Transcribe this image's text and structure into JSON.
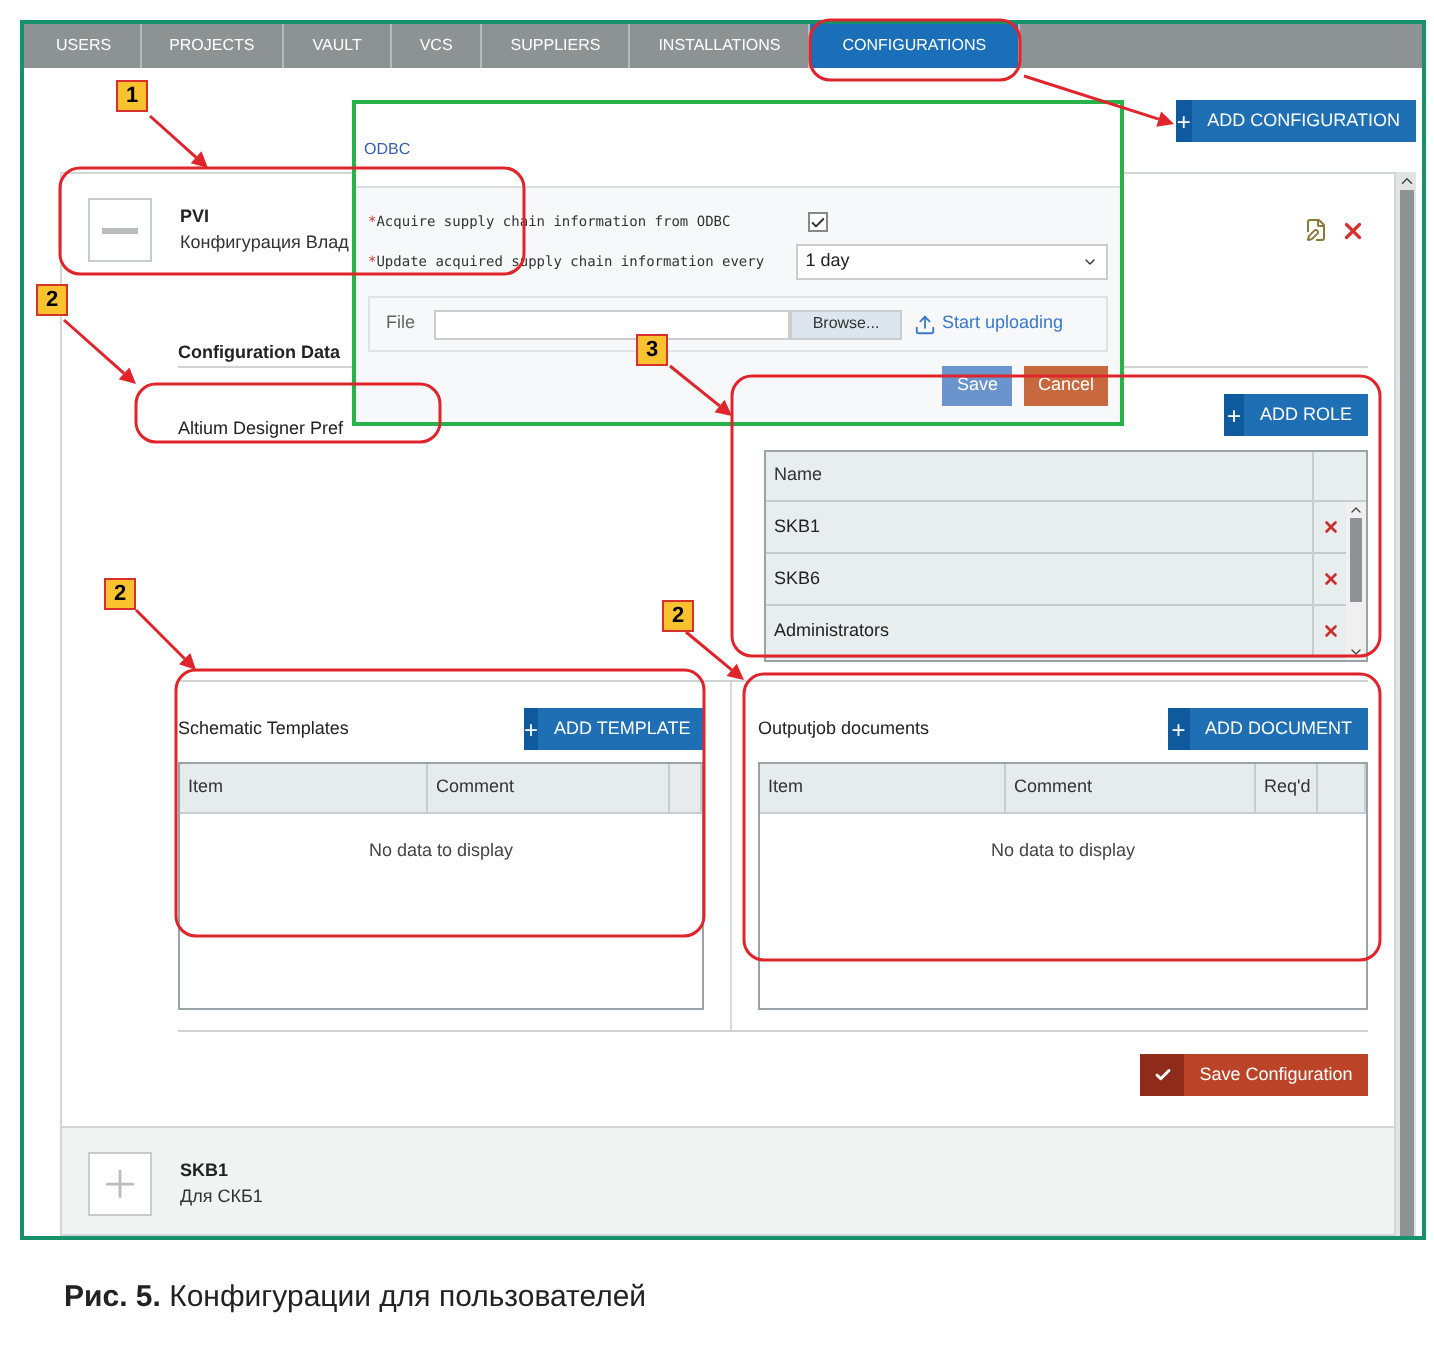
{
  "tabs": [
    {
      "label": "USERS",
      "selected": false
    },
    {
      "label": "PROJECTS",
      "selected": false
    },
    {
      "label": "VAULT",
      "selected": false
    },
    {
      "label": "VCS",
      "selected": false
    },
    {
      "label": "SUPPLIERS",
      "selected": false
    },
    {
      "label": "INSTALLATIONS",
      "selected": false
    },
    {
      "label": "CONFIGURATIONS",
      "selected": true
    }
  ],
  "add_configuration_button": {
    "icon": "+",
    "label": "ADD CONFIGURATION"
  },
  "configurations": [
    {
      "name": "PVI",
      "description": "Конфигурация Влад",
      "expanded": true
    },
    {
      "name": "SKB1",
      "description": "Для СКБ1",
      "expanded": false
    }
  ],
  "configuration_data": {
    "heading": "Configuration Data",
    "preferences": "Altium Designer Pref",
    "add_role_button": {
      "icon": "+",
      "label": "ADD ROLE"
    },
    "roles_table": {
      "columns": [
        "Name"
      ],
      "rows": [
        "SKB1",
        "SKB6",
        "Administrators"
      ]
    },
    "templates": {
      "heading": "Schematic Templates",
      "button": {
        "icon": "+",
        "label": "ADD TEMPLATE"
      },
      "columns": [
        "Item",
        "Comment"
      ],
      "empty": "No data to display"
    },
    "documents": {
      "heading": "Outputjob documents",
      "button": {
        "icon": "+",
        "label": "ADD DOCUMENT"
      },
      "columns": [
        "Item",
        "Comment",
        "Req'd"
      ],
      "empty": "No data to display"
    },
    "save_button": "Save Configuration"
  },
  "odbc_dialog": {
    "title": "ODBC",
    "acquire": {
      "mark": "*",
      "label": "Acquire supply chain information from ODBC",
      "checked": true
    },
    "update": {
      "mark": "*",
      "label": "Update acquired supply chain information every",
      "value": "1 day"
    },
    "file": {
      "label": "File",
      "browse": "Browse...",
      "upload": "Start uploading"
    },
    "buttons": [
      "Save",
      "Cancel"
    ]
  },
  "annotations": [
    "1",
    "2",
    "2",
    "2",
    "3"
  ],
  "caption": "**Рис. 5.** Конфигурации для пользователей"
}
